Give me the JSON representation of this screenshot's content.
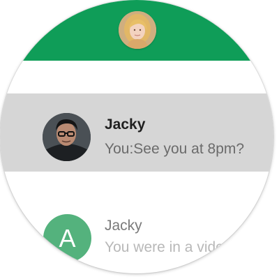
{
  "theme": {
    "header_color": "#0f9d58",
    "highlight_color": "#d6d6d6",
    "letter_avatar_color": "#54b27d"
  },
  "header": {
    "avatar_icon": "contact-photo-woman"
  },
  "conversations": [
    {
      "name": "Jacky",
      "preview": "You:See you at 8pm?",
      "avatar_icon": "contact-photo-man",
      "selected": true
    },
    {
      "name": "Jacky",
      "preview": "You were in a video call",
      "avatar_letter": "A",
      "selected": false
    }
  ]
}
